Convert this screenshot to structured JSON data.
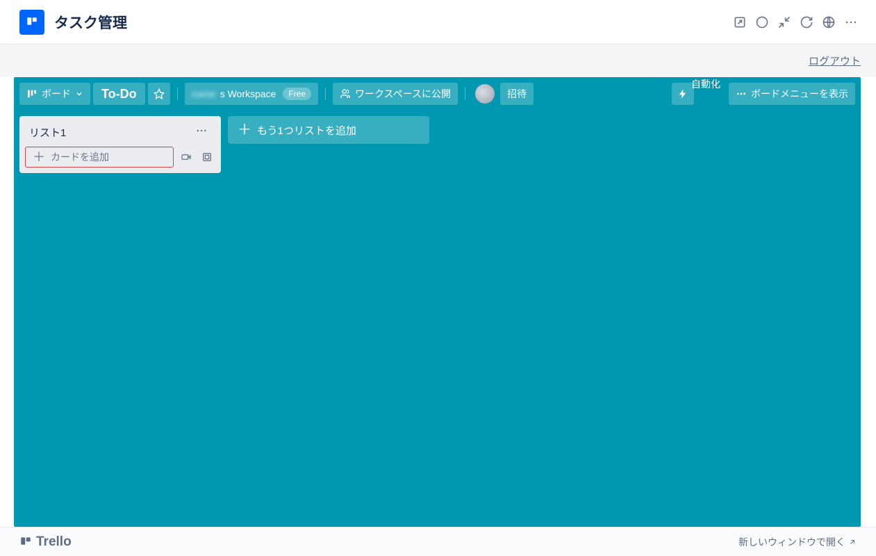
{
  "app": {
    "title": "タスク管理"
  },
  "subbar": {
    "logout": "ログアウト"
  },
  "header": {
    "board_label": "ボード",
    "board_name": "To-Do",
    "workspace_name": "s Workspace",
    "workspace_tier": "Free",
    "visibility": "ワークスペースに公開",
    "invite": "招待",
    "automation": "自動化",
    "show_menu": "ボードメニューを表示"
  },
  "lists": [
    {
      "title": "リスト1",
      "add_card": "カードを追加"
    }
  ],
  "add_list": "もう1つリストを追加",
  "footer": {
    "brand": "Trello",
    "open_new": "新しいウィンドウで開く"
  }
}
